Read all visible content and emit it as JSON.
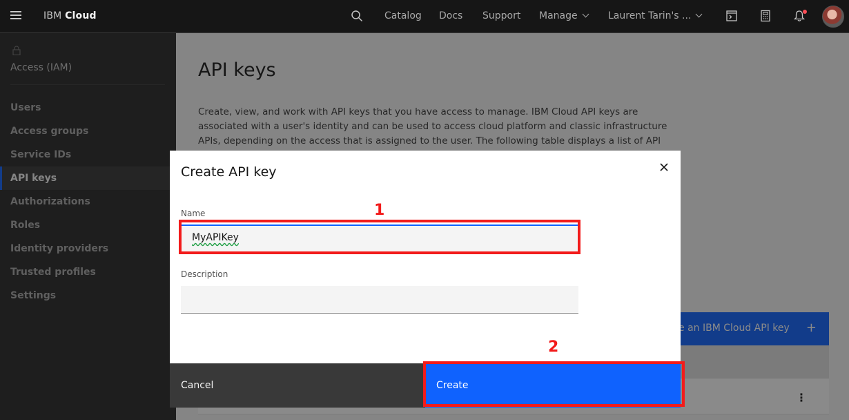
{
  "topbar": {
    "brand_prefix": "IBM",
    "brand_name": "Cloud",
    "nav": [
      "Catalog",
      "Docs",
      "Support",
      "Manage"
    ],
    "account": "Laurent Tarin's ...",
    "icons": [
      "menu-icon",
      "search-icon",
      "terminal-icon",
      "calculator-icon",
      "notification-icon",
      "avatar"
    ]
  },
  "sidebar": {
    "section_title": "Access (IAM)",
    "items": [
      "Users",
      "Access groups",
      "Service IDs",
      "API keys",
      "Authorizations",
      "Roles",
      "Identity providers",
      "Trusted profiles",
      "Settings"
    ],
    "active_item": "API keys"
  },
  "page": {
    "title": "API keys",
    "description": "Create, view, and work with API keys that you have access to manage. IBM Cloud API keys are associated with a user's identity and can be used to access cloud platform and classic infrastructure APIs, depending on the access that is assigned to the user. The following table displays a list of API keys created in this",
    "create_button": "e an IBM Cloud API key",
    "create_button_icon": "+",
    "row_menu": "⋮"
  },
  "modal": {
    "title": "Create API key",
    "name_label": "Name",
    "name_value": "MyAPIKey",
    "description_label": "Description",
    "description_value": "",
    "cancel_label": "Cancel",
    "create_label": "Create"
  },
  "annotations": {
    "step1": "1",
    "step2": "2",
    "color": "#f21b1b"
  },
  "colors": {
    "primary": "#0f62fe",
    "topbar": "#161616",
    "sidebar": "#262626"
  }
}
